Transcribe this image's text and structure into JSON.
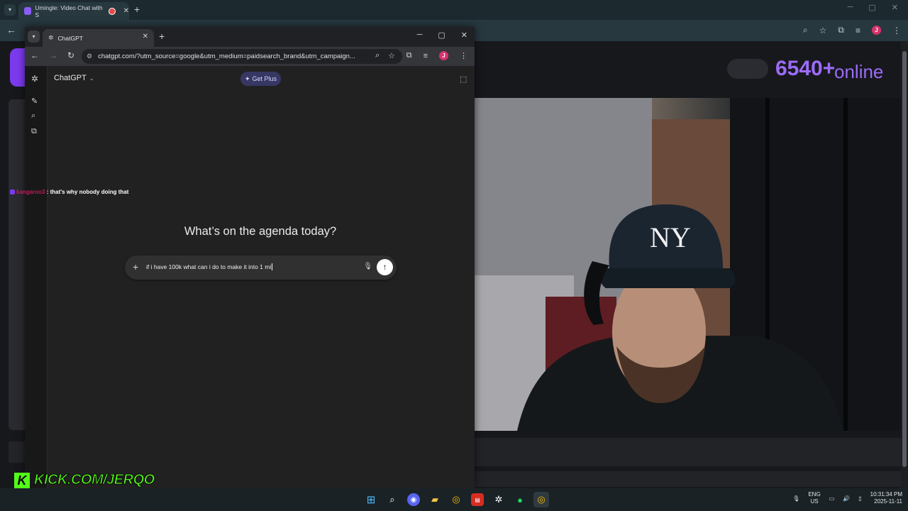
{
  "background_browser": {
    "tab_title": "Umingle: Video Chat with S",
    "online_count": "6540+",
    "online_label": "online"
  },
  "chatgpt_window": {
    "tab_title": "ChatGPT",
    "url": "chatgpt.com/?utm_source=google&utm_medium=paidsearch_brand&utm_campaign...",
    "model_label": "ChatGPT",
    "get_plus_label": "Get Plus",
    "heading": "What’s on the agenda today?",
    "composer_text": "if i have 100k what can i do to make it into 1 mi",
    "profile_initial": "J"
  },
  "chat_overlay": {
    "username": "kangaroo3",
    "message": ": that's why nobody doing that"
  },
  "stream_overlay": {
    "kick_letter": "K",
    "channel": "KICK.COM/JERQO"
  },
  "taskbar": {
    "language_line1": "ENG",
    "language_line2": "US",
    "time": "10:31:34 PM",
    "date": "2025-11-11"
  },
  "colors": {
    "accent_purple": "#9b6cf7",
    "kick_green": "#53fc18",
    "chat_username": "#c2185b",
    "get_plus_bg": "#373764"
  },
  "icons": {
    "sidebar": [
      "openai-logo-icon",
      "new-chat-icon",
      "search-icon",
      "library-icon"
    ]
  }
}
